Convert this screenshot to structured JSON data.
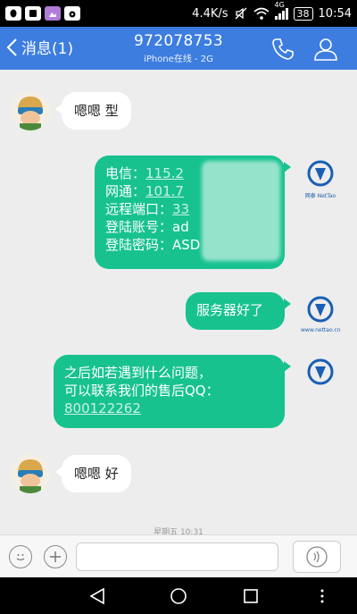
{
  "status_bar": {
    "speed": "4.4K/s",
    "network": "4G",
    "battery": "38",
    "time": "10:54"
  },
  "header": {
    "back_label": "消息(1)",
    "title": "972078753",
    "subtitle": "iPhone在线 - 2G",
    "accent_color": "#3d7de0"
  },
  "messages": [
    {
      "side": "in",
      "text": "嗯嗯 型"
    },
    {
      "side": "out",
      "rows": [
        {
          "label": "电信：",
          "value": "115.2"
        },
        {
          "label": "网通：",
          "value": "101.7"
        },
        {
          "label": "远程端口：",
          "value": "33"
        },
        {
          "label": "登陆账号：",
          "value": "ad"
        },
        {
          "label": "登陆密码：",
          "value": "ASD"
        }
      ]
    },
    {
      "side": "out",
      "text": "服务器好了"
    },
    {
      "side": "out",
      "line1": "之后如若遇到什么问题，",
      "line2": "可以联系我们的售后QQ：",
      "qq": "800122262"
    },
    {
      "side": "in",
      "text": "嗯嗯 好"
    }
  ],
  "brand": {
    "logo_text": "网泰 NetTao",
    "logo_sub": "www.nettao.cn",
    "color": "#1b5fb5"
  },
  "bubble_color": "#17c28f",
  "time_label": "星期五 10:31",
  "input": {
    "placeholder": ""
  }
}
